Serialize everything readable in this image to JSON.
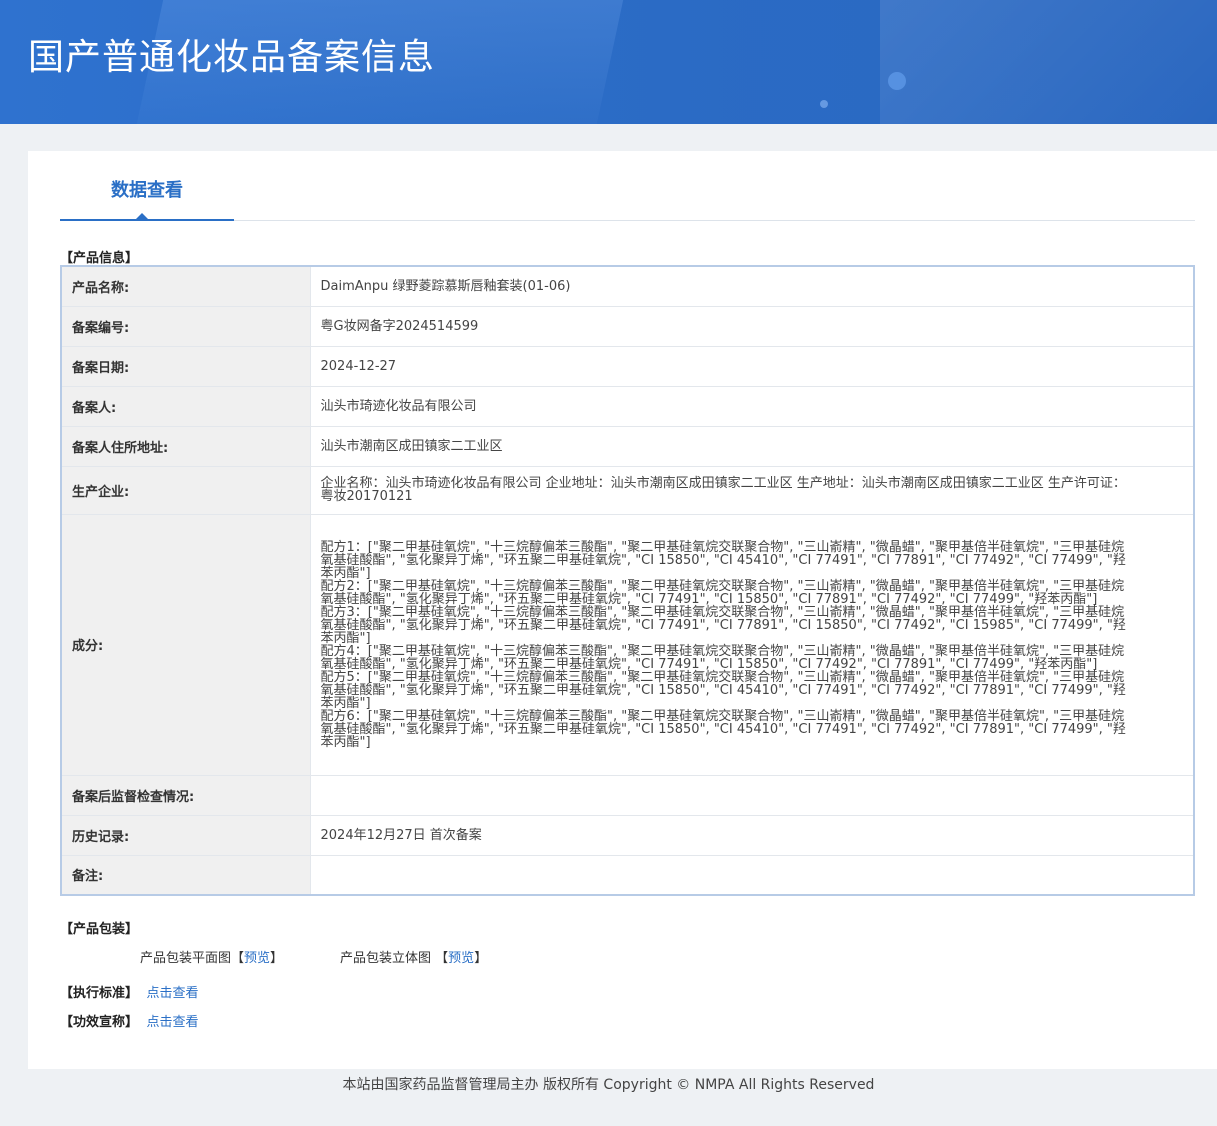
{
  "header": {
    "title": "国产普通化妆品备案信息"
  },
  "tabs": [
    {
      "label": "数据查看"
    }
  ],
  "product_section": {
    "title": "【产品信息】",
    "rows": [
      {
        "label": "产品名称:",
        "value": "DaimAnpu 绿野菱踪慕斯唇釉套装(01-06)"
      },
      {
        "label": "备案编号:",
        "value": "粤G妆网备字2024514599"
      },
      {
        "label": "备案日期:",
        "value": "2024-12-27"
      },
      {
        "label": "备案人:",
        "value": "汕头市琦迹化妆品有限公司"
      },
      {
        "label": "备案人住所地址:",
        "value": "汕头市潮南区成田镇家二工业区"
      },
      {
        "label": "生产企业:",
        "value": "企业名称：汕头市琦迹化妆品有限公司 企业地址：汕头市潮南区成田镇家二工业区 生产地址：汕头市潮南区成田镇家二工业区 生产许可证：粤妆20170121"
      },
      {
        "label": "成分:",
        "formulas": [
          "配方1：[\"聚二甲基硅氧烷\", \"十三烷醇偏苯三酸酯\", \"聚二甲基硅氧烷交联聚合物\", \"三山嵛精\", \"微晶蜡\", \"聚甲基倍半硅氧烷\", \"三甲基硅烷氧基硅酸酯\", \"氢化聚异丁烯\", \"环五聚二甲基硅氧烷\", \"CI 15850\", \"CI 45410\", \"CI 77491\", \"CI 77891\", \"CI 77492\", \"CI 77499\", \"羟苯丙酯\"]",
          "配方2：[\"聚二甲基硅氧烷\", \"十三烷醇偏苯三酸酯\", \"聚二甲基硅氧烷交联聚合物\", \"三山嵛精\", \"微晶蜡\", \"聚甲基倍半硅氧烷\", \"三甲基硅烷氧基硅酸酯\", \"氢化聚异丁烯\", \"环五聚二甲基硅氧烷\", \"CI 77491\", \"CI 15850\", \"CI 77891\", \"CI 77492\", \"CI 77499\", \"羟苯丙酯\"]",
          "配方3：[\"聚二甲基硅氧烷\", \"十三烷醇偏苯三酸酯\", \"聚二甲基硅氧烷交联聚合物\", \"三山嵛精\", \"微晶蜡\", \"聚甲基倍半硅氧烷\", \"三甲基硅烷氧基硅酸酯\", \"氢化聚异丁烯\", \"环五聚二甲基硅氧烷\", \"CI 77491\", \"CI 77891\", \"CI 15850\", \"CI 77492\", \"CI 15985\", \"CI 77499\", \"羟苯丙酯\"]",
          "配方4：[\"聚二甲基硅氧烷\", \"十三烷醇偏苯三酸酯\", \"聚二甲基硅氧烷交联聚合物\", \"三山嵛精\", \"微晶蜡\", \"聚甲基倍半硅氧烷\", \"三甲基硅烷氧基硅酸酯\", \"氢化聚异丁烯\", \"环五聚二甲基硅氧烷\", \"CI 77491\", \"CI 15850\", \"CI 77492\", \"CI 77891\", \"CI 77499\", \"羟苯丙酯\"]",
          "配方5：[\"聚二甲基硅氧烷\", \"十三烷醇偏苯三酸酯\", \"聚二甲基硅氧烷交联聚合物\", \"三山嵛精\", \"微晶蜡\", \"聚甲基倍半硅氧烷\", \"三甲基硅烷氧基硅酸酯\", \"氢化聚异丁烯\", \"环五聚二甲基硅氧烷\", \"CI 15850\", \"CI 45410\", \"CI 77491\", \"CI 77492\", \"CI 77891\", \"CI 77499\", \"羟苯丙酯\"]",
          "配方6：[\"聚二甲基硅氧烷\", \"十三烷醇偏苯三酸酯\", \"聚二甲基硅氧烷交联聚合物\", \"三山嵛精\", \"微晶蜡\", \"聚甲基倍半硅氧烷\", \"三甲基硅烷氧基硅酸酯\", \"氢化聚异丁烯\", \"环五聚二甲基硅氧烷\", \"CI 15850\", \"CI 45410\", \"CI 77491\", \"CI 77492\", \"CI 77891\", \"CI 77499\", \"羟苯丙酯\"]"
        ]
      },
      {
        "label": "备案后监督检查情况:",
        "value": ""
      },
      {
        "label": "历史记录:",
        "value": "2024年12月27日 首次备案"
      },
      {
        "label": "备注:",
        "value": ""
      }
    ]
  },
  "packaging": {
    "title": "【产品包装】",
    "flat_label": "产品包装平面图",
    "flat_preview": "预览",
    "solid_label": "产品包装立体图",
    "solid_preview": "预览",
    "bracket_open": "【",
    "bracket_close": "】"
  },
  "standard": {
    "title": "【执行标准】",
    "link": "点击查看"
  },
  "efficacy": {
    "title": "【功效宣称】",
    "link": "点击查看"
  },
  "footer": {
    "text": "本站由国家药品监督管理局主办 版权所有 Copyright © NMPA All Rights Reserved"
  },
  "colors": {
    "accent": "#2a6fc6",
    "header_bg": "#2b6cc6",
    "label_bg": "#f0f0f0",
    "table_border": "#b7cbe6"
  }
}
